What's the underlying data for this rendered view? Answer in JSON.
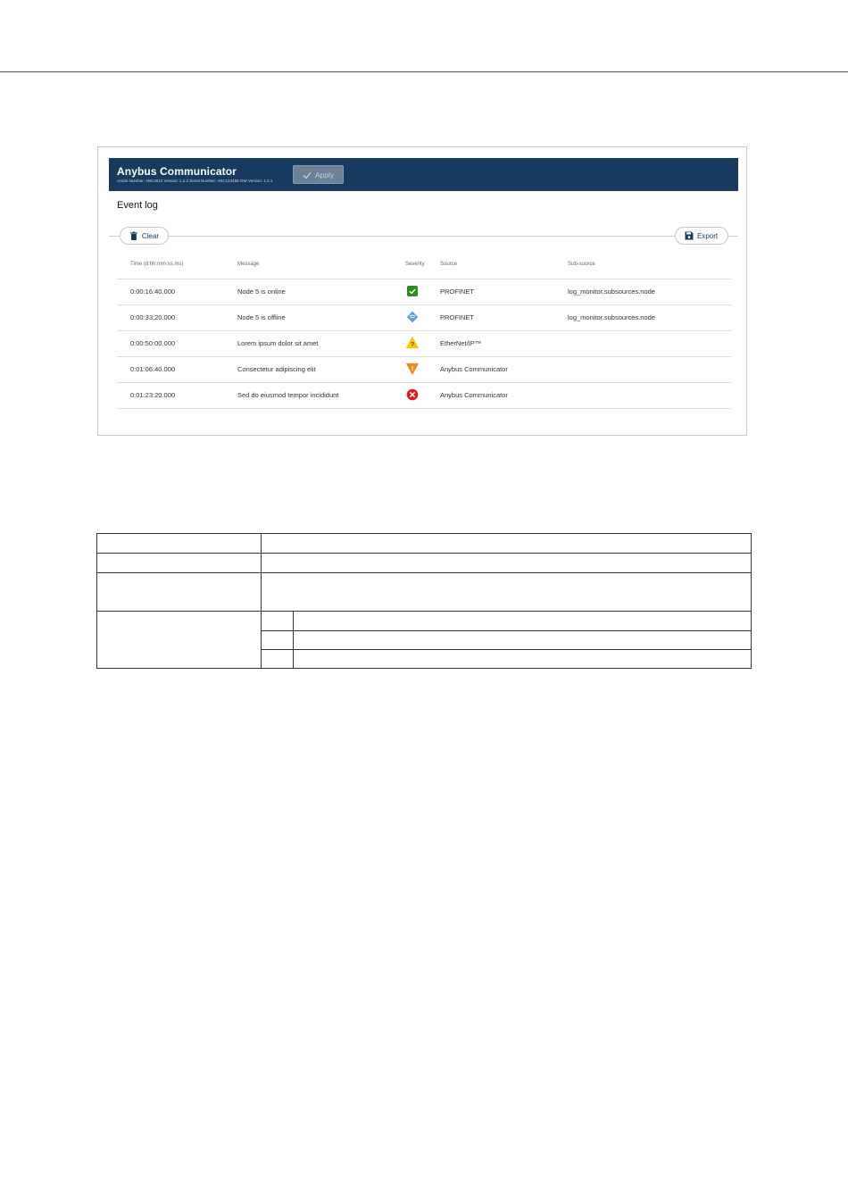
{
  "app": {
    "title": "Anybus Communicator",
    "subtitle": "Article Number: ABC4012  Version: 1.2.2  Serial Number: ABC123456  GW Version: 1.0.1",
    "apply_label": "Apply"
  },
  "page": {
    "title": "Event log"
  },
  "toolbar": {
    "clear_label": "Clear",
    "export_label": "Export"
  },
  "table": {
    "headers": [
      "Time (d:hh:mm:ss.ms)",
      "Message",
      "Severity",
      "Source",
      "Sub-source"
    ],
    "rows": [
      {
        "time": "0:00:16:40.000",
        "message": "Node 5 is online",
        "severity": "info-success",
        "source": "PROFINET",
        "subsource": "log_monitor.subsources.node"
      },
      {
        "time": "0:00:33:20.000",
        "message": "Node 5 is offline",
        "severity": "notice",
        "source": "PROFINET",
        "subsource": "log_monitor.subsources.node"
      },
      {
        "time": "0:00:50:00.000",
        "message": "Lorem ipsum dolor sit amet",
        "severity": "warning",
        "source": "EtherNet/IP™",
        "subsource": ""
      },
      {
        "time": "0:01:06:40.000",
        "message": "Consectetur adipiscing elit",
        "severity": "alert",
        "source": "Anybus Communicator",
        "subsource": ""
      },
      {
        "time": "0:01:23:20.000",
        "message": "Sed do eiusmod tempor incididunt",
        "severity": "error",
        "source": "Anybus Communicator",
        "subsource": ""
      }
    ]
  },
  "colors": {
    "appbar": "#173a5e",
    "success": "#2e8b1f",
    "notice": "#5b9bd5",
    "warning": "#f2c811",
    "alert": "#f08a1c",
    "error": "#d61f26"
  }
}
